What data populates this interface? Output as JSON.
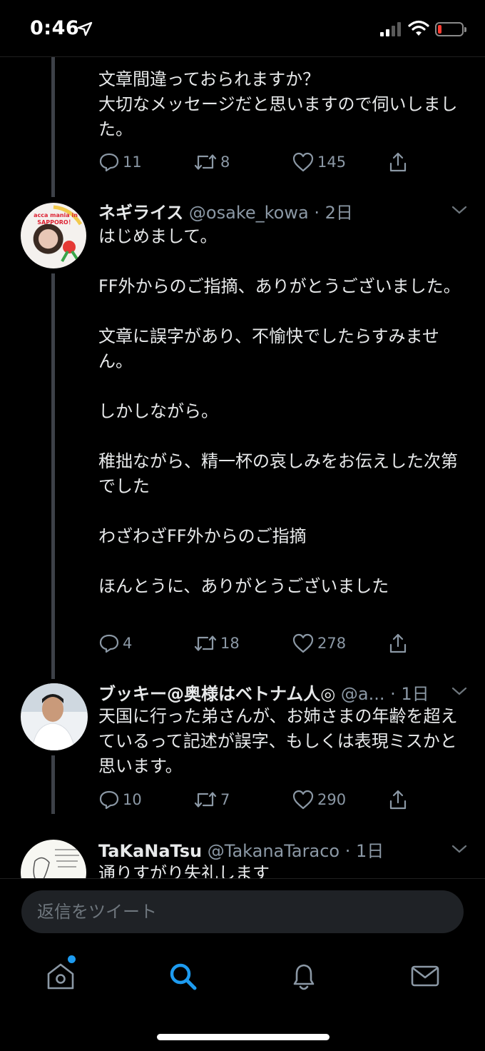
{
  "status_bar": {
    "time": "0:46"
  },
  "tweets": [
    {
      "text": "文章間違っておられますか？\n大切なメッセージだと思いますので伺いしました。",
      "replies": "11",
      "retweets": "8",
      "likes": "145"
    },
    {
      "name": "ネギライス",
      "handle": "@osake_kowa",
      "time": "· 2日",
      "avatar_text": "acca mania in SAPPORO！",
      "text": "はじめまして。\n\nFF外からのご指摘、ありがとうございました。\n\n文章に誤字があり、不愉快でしたらすみません。\n\nしかしながら。\n\n稚拙ながら、精一杯の哀しみをお伝えした次第でした\n\nわざわざFF外からのご指摘\n\nほんとうに、ありがとうございました",
      "replies": "4",
      "retweets": "18",
      "likes": "278"
    },
    {
      "name": "ブッキー@奥様はベトナム人◎",
      "handle": "@a...",
      "time": "· 1日",
      "text": "天国に行った弟さんが、お姉さまの年齢を超えているって記述が誤字、もしくは表現ミスかと思います。",
      "replies": "10",
      "retweets": "7",
      "likes": "290"
    },
    {
      "name": "TaKaNaTsu",
      "handle": "@TakanaTaraco",
      "time": "· 1日",
      "text": "通りすがり失礼します"
    }
  ],
  "reply_bar": {
    "placeholder": "返信をツイート"
  },
  "tabs": [
    "home-icon",
    "search-icon",
    "notifications-icon",
    "messages-icon"
  ],
  "colors": {
    "accent": "#1d9bf0",
    "background": "#000000",
    "muted": "#8b98a5",
    "battery_low": "#ff3b30"
  }
}
